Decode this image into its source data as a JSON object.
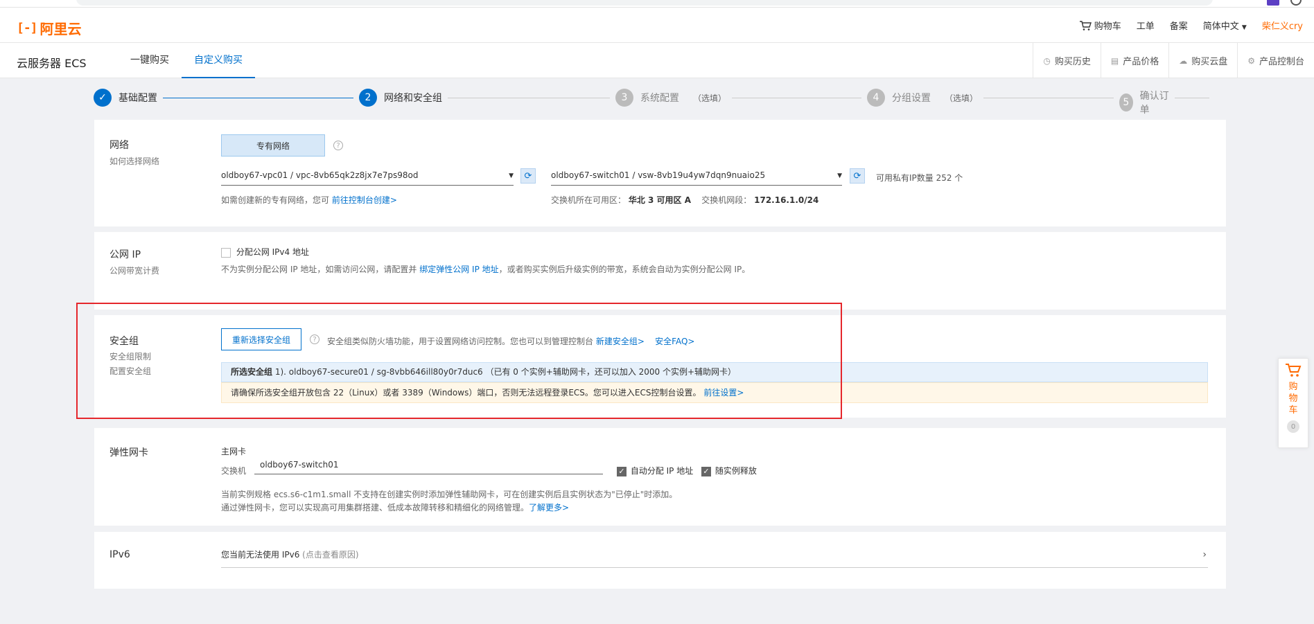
{
  "topbar": {
    "logo": "阿里云",
    "cart": "购物车",
    "ticket": "工单",
    "record": "备案",
    "language": "简体中文",
    "user": "柴仁义cry"
  },
  "subbar": {
    "title": "云服务器 ECS",
    "tabs": [
      {
        "label": "一键购买"
      },
      {
        "label": "自定义购买"
      }
    ],
    "right_items": [
      {
        "label": "购买历史"
      },
      {
        "label": "产品价格"
      },
      {
        "label": "购买云盘"
      },
      {
        "label": "产品控制台"
      }
    ]
  },
  "steps": [
    {
      "label": "基础配置",
      "num": "✓"
    },
    {
      "label": "网络和安全组",
      "num": "2"
    },
    {
      "label": "系统配置",
      "num": "3",
      "optional": "（选填）"
    },
    {
      "label": "分组设置",
      "num": "4",
      "optional": "（选填）"
    },
    {
      "label": "确认订单",
      "num": "5"
    }
  ],
  "network": {
    "label": "网络",
    "sublabel": "如何选择网络",
    "type_button": "专有网络",
    "vpc_value": "oldboy67-vpc01 / vpc-8vb65qk2z8jx7e7ps98od",
    "switch_value": "oldboy67-switch01 / vsw-8vb19u4yw7dqn9nuaio25",
    "available_ip": "可用私有IP数量 252 个",
    "create_hint": "如需创建新的专有网络，您可",
    "create_link": "前往控制台创建>",
    "zone_label": "交换机所在可用区：",
    "zone_value": "华北 3 可用区 A",
    "cidr_label": "交换机网段：",
    "cidr_value": "172.16.1.0/24"
  },
  "public_ip": {
    "label": "公网 IP",
    "sublabel": "公网带宽计费",
    "checkbox_label": "分配公网 IPv4 地址",
    "hint_prefix": "不为实例分配公网 IP 地址，如需访问公网，请配置并 ",
    "hint_link": "绑定弹性公网 IP 地址",
    "hint_suffix": "，或者购买实例后升级实例的带宽，系统会自动为实例分配公网 IP。"
  },
  "security": {
    "label": "安全组",
    "sublabel1": "安全组限制",
    "sublabel2": "配置安全组",
    "reselect_button": "重新选择安全组",
    "desc": "安全组类似防火墙功能，用于设置网络访问控制。您也可以到管理控制台",
    "new_link": "新建安全组>",
    "faq_link": "安全FAQ>",
    "selected_label": "所选安全组",
    "selected_value": "1). oldboy67-secure01 / sg-8vbb646ill80y0r7duc6 （已有 0 个实例+辅助网卡，还可以加入 2000 个实例+辅助网卡）",
    "warning": "请确保所选安全组开放包含 22（Linux）或者 3389（Windows）端口，否则无法远程登录ECS。您可以进入ECS控制台设置。",
    "warning_link": "前往设置>"
  },
  "eni": {
    "label": "弹性网卡",
    "primary": "主网卡",
    "switch_label": "交换机",
    "switch_value": "oldboy67-switch01",
    "auto_ip": "自动分配 IP 地址",
    "release_with": "随实例释放",
    "note1": "当前实例规格 ecs.s6-c1m1.small 不支持在创建实例时添加弹性辅助网卡，可在创建实例后且实例状态为\"已停止\"时添加。",
    "note2": "通过弹性网卡，您可以实现高可用集群搭建、低成本故障转移和精细化的网络管理。",
    "more_link": "了解更多>"
  },
  "ipv6": {
    "label": "IPv6",
    "text": "您当前无法使用 IPv6",
    "reason": "(点击查看原因)"
  },
  "float_cart": {
    "label": "购物车",
    "count": "0"
  },
  "colors": {
    "brand": "#ff6a00",
    "primary": "#0070cc",
    "highlight": "#e5262b"
  }
}
